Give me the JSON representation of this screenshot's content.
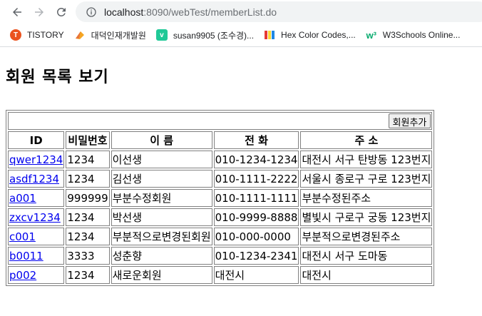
{
  "browser": {
    "url_host": "localhost",
    "url_path": ":8090/webTest/memberList.do",
    "bookmarks": [
      {
        "label": "TISTORY",
        "icon": "tistory-icon",
        "glyph": "T"
      },
      {
        "label": "대덕인재개발원",
        "icon": "daedeok-icon",
        "glyph": "◢"
      },
      {
        "label": "susan9905 (조수경)...",
        "icon": "velog-icon",
        "glyph": "v"
      },
      {
        "label": "Hex Color Codes,...",
        "icon": "hex-color-icon",
        "glyph": "▮"
      },
      {
        "label": "W3Schools Online...",
        "icon": "w3schools-icon",
        "glyph": "w³"
      }
    ]
  },
  "page": {
    "title": "회원 목록 보기",
    "add_button": "회원추가"
  },
  "table": {
    "headers": [
      "ID",
      "비밀번호",
      "이 름",
      "전 화",
      "주 소"
    ],
    "rows": [
      [
        "qwer1234",
        "1234",
        "이선생",
        "010-1234-1234",
        "대전시 서구 탄방동 123번지"
      ],
      [
        "asdf1234",
        "1234",
        "김선생",
        "010-1111-2222",
        "서울시 종로구 구로 123번지"
      ],
      [
        "a001",
        "999999",
        "부분수정회원",
        "010-1111-1111",
        "부분수정된주소"
      ],
      [
        "zxcv1234",
        "1234",
        "박선생",
        "010-9999-8888",
        "별빛시 구로구 궁동 123번지"
      ],
      [
        "c001",
        "1234",
        "부분적으로변경된회원",
        "010-000-0000",
        "부분적으로변경된주소"
      ],
      [
        "b0011",
        "3333",
        "성춘향",
        "010-1234-2341",
        "대전시 서구 도마동"
      ],
      [
        "p002",
        "1234",
        "새로운회원",
        "대전시",
        "대전시"
      ]
    ]
  }
}
